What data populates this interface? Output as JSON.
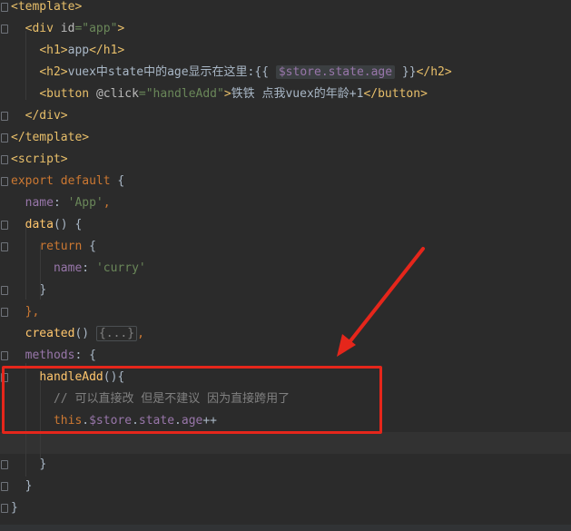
{
  "editor": {
    "lines": [
      {
        "tokens": [
          {
            "t": "<template>",
            "c": "t-tag"
          }
        ]
      },
      {
        "tokens": [
          {
            "t": "  "
          },
          {
            "t": "<div ",
            "c": "t-tag"
          },
          {
            "t": "id",
            "c": "t-attr"
          },
          {
            "t": "=\"app\"",
            "c": "t-str"
          },
          {
            "t": ">",
            "c": "t-tag"
          }
        ]
      },
      {
        "tokens": [
          {
            "t": "    "
          },
          {
            "t": "<h1>",
            "c": "t-tag"
          },
          {
            "t": "app"
          },
          {
            "t": "</h1>",
            "c": "t-tag"
          }
        ]
      },
      {
        "tokens": [
          {
            "t": "    "
          },
          {
            "t": "<h2>",
            "c": "t-tag"
          },
          {
            "t": "vuex中state中的age显示在这里:{{ "
          },
          {
            "t": "$store.state.age",
            "c": "interp"
          },
          {
            "t": " }}"
          },
          {
            "t": "</h2>",
            "c": "t-tag"
          }
        ]
      },
      {
        "tokens": [
          {
            "t": "    "
          },
          {
            "t": "<button ",
            "c": "t-tag"
          },
          {
            "t": "@click",
            "c": "t-attr"
          },
          {
            "t": "=\"handleAdd\"",
            "c": "t-str"
          },
          {
            "t": ">",
            "c": "t-tag"
          },
          {
            "t": "铁铁 点我vuex的年龄+1"
          },
          {
            "t": "</button>",
            "c": "t-tag"
          }
        ]
      },
      {
        "tokens": [
          {
            "t": "  "
          },
          {
            "t": "</div>",
            "c": "t-tag"
          }
        ]
      },
      {
        "tokens": [
          {
            "t": "</template>",
            "c": "t-tag"
          }
        ]
      },
      {
        "tokens": [
          {
            "t": "<script>",
            "c": "t-tag"
          }
        ]
      },
      {
        "tokens": [
          {
            "t": "export default ",
            "c": "t-kw"
          },
          {
            "t": "{"
          }
        ]
      },
      {
        "tokens": [
          {
            "t": "  "
          },
          {
            "t": "name",
            "c": "t-prop"
          },
          {
            "t": ": "
          },
          {
            "t": "'App'",
            "c": "t-str"
          },
          {
            "t": ",",
            "c": "t-kw"
          }
        ]
      },
      {
        "tokens": [
          {
            "t": "  "
          },
          {
            "t": "data",
            "c": "t-fn"
          },
          {
            "t": "() {"
          }
        ]
      },
      {
        "tokens": [
          {
            "t": "    "
          },
          {
            "t": "return ",
            "c": "t-kw"
          },
          {
            "t": "{"
          }
        ]
      },
      {
        "tokens": [
          {
            "t": "      "
          },
          {
            "t": "name",
            "c": "t-prop"
          },
          {
            "t": ": "
          },
          {
            "t": "'curry'",
            "c": "t-str"
          }
        ]
      },
      {
        "tokens": [
          {
            "t": "    "
          },
          {
            "t": "}"
          }
        ]
      },
      {
        "tokens": [
          {
            "t": "  "
          },
          {
            "t": "},",
            "c": "t-kw"
          }
        ]
      },
      {
        "tokens": [
          {
            "t": "  "
          },
          {
            "t": "created",
            "c": "t-fn"
          },
          {
            "t": "() "
          },
          {
            "t": "{...}",
            "c": "collapsed"
          },
          {
            "t": ",",
            "c": "t-kw"
          }
        ]
      },
      {
        "tokens": [
          {
            "t": "  "
          },
          {
            "t": "methods",
            "c": "t-prop"
          },
          {
            "t": ": {"
          }
        ]
      },
      {
        "tokens": [
          {
            "t": "    "
          },
          {
            "t": "handleAdd",
            "c": "t-fn"
          },
          {
            "t": "(){"
          }
        ]
      },
      {
        "tokens": [
          {
            "t": "      "
          },
          {
            "t": "// 可以直接改 但是不建议 因为直接跨用了",
            "c": "t-cmt"
          }
        ]
      },
      {
        "tokens": [
          {
            "t": "      "
          },
          {
            "t": "this",
            "c": "t-this"
          },
          {
            "t": "."
          },
          {
            "t": "$store",
            "c": "t-prop"
          },
          {
            "t": "."
          },
          {
            "t": "state",
            "c": "t-prop"
          },
          {
            "t": "."
          },
          {
            "t": "age",
            "c": "t-prop"
          },
          {
            "t": "++"
          }
        ]
      },
      {
        "tokens": [
          {
            "t": ""
          }
        ],
        "current": true
      },
      {
        "tokens": [
          {
            "t": "    "
          },
          {
            "t": "}"
          }
        ]
      },
      {
        "tokens": [
          {
            "t": "  "
          },
          {
            "t": "}"
          }
        ]
      },
      {
        "tokens": [
          {
            "t": "}"
          }
        ]
      }
    ],
    "colors": {
      "background": "#2b2b2b",
      "tag": "#e8bf6a",
      "string": "#6a8759",
      "keyword": "#cc7832",
      "property": "#9876aa",
      "function": "#ffc66d",
      "comment": "#808080",
      "annotation_red": "#e5261b"
    }
  }
}
